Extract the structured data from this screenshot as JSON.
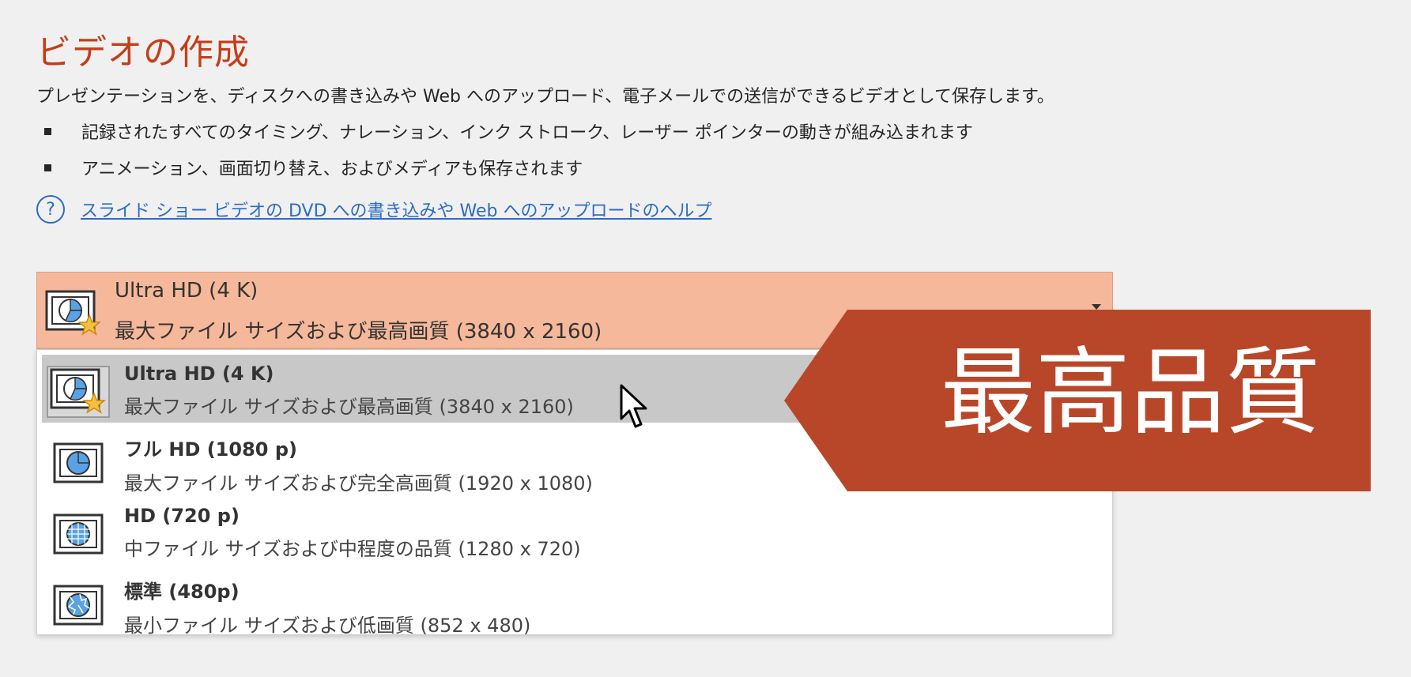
{
  "title": "ビデオの作成",
  "description": "プレゼンテーションを、ディスクへの書き込みや Web へのアップロード、電子メールでの送信ができるビデオとして保存します。",
  "bullets": [
    "記録されたすべてのタイミング、ナレーション、インク ストローク、レーザー ポインターの動きが組み込まれます",
    "アニメーション、画面切り替え、およびメディアも保存されます"
  ],
  "help": {
    "icon": "question-icon",
    "link_text": "スライド ショー ビデオの DVD への書き込みや Web へのアップロードのヘルプ"
  },
  "dropdown": {
    "selected": {
      "title": "Ultra HD (4 K)",
      "subtitle": "最大ファイル サイズおよび最高画質 (3840 x 2160)"
    },
    "options": [
      {
        "title": "Ultra HD (4 K)",
        "subtitle": "最大ファイル サイズおよび最高画質 (3840 x 2160)",
        "icon": "ultra-hd-icon",
        "hovered": true
      },
      {
        "title": "フル HD (1080 p)",
        "subtitle": "最大ファイル サイズおよび完全高画質 (1920 x 1080)",
        "icon": "full-hd-icon",
        "hovered": false
      },
      {
        "title": "HD (720 p)",
        "subtitle": "中ファイル サイズおよび中程度の品質 (1280 x 720)",
        "icon": "hd-icon",
        "hovered": false
      },
      {
        "title": "標準 (480p)",
        "subtitle": "最小ファイル サイズおよび低画質 (852 x 480)",
        "icon": "standard-icon",
        "hovered": false
      }
    ]
  },
  "callout": {
    "text": "最高品質",
    "color": "#b8472a"
  },
  "colors": {
    "title": "#c43e1c",
    "link": "#2b6cc4",
    "selected_bg": "#f5b89a",
    "hover_bg": "#c8c8c8"
  }
}
